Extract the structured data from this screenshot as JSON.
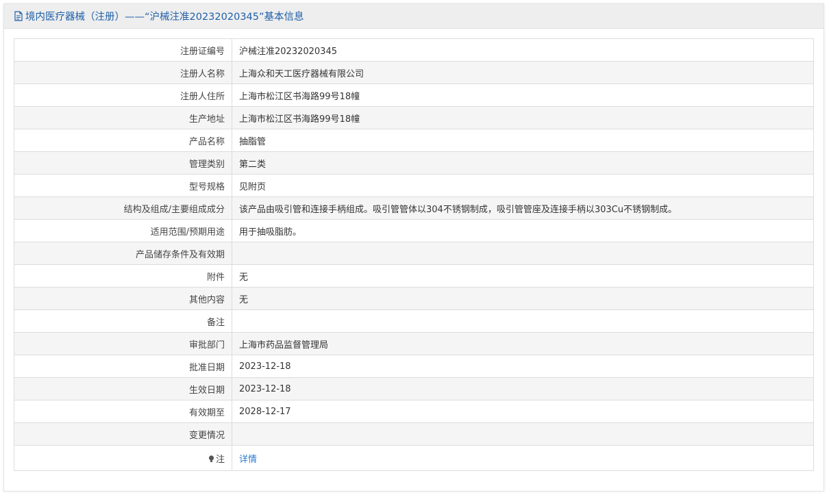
{
  "header": {
    "title": "境内医疗器械（注册）——“沪械注准20232020345”基本信息",
    "icon": "document-icon",
    "color": "#1e5fa8"
  },
  "rows": [
    {
      "label": "注册证编号",
      "value": "沪械注准20232020345"
    },
    {
      "label": "注册人名称",
      "value": "上海众和天工医疗器械有限公司"
    },
    {
      "label": "注册人住所",
      "value": "上海市松江区书海路99号18幢"
    },
    {
      "label": "生产地址",
      "value": "上海市松江区书海路99号18幢"
    },
    {
      "label": "产品名称",
      "value": "抽脂管"
    },
    {
      "label": "管理类别",
      "value": "第二类"
    },
    {
      "label": "型号规格",
      "value": "见附页"
    },
    {
      "label": "结构及组成/主要组成成分",
      "value": "该产品由吸引管和连接手柄组成。吸引管管体以304不锈钢制成，吸引管管座及连接手柄以303Cu不锈钢制成。"
    },
    {
      "label": "适用范围/预期用途",
      "value": "用于抽吸脂肪。"
    },
    {
      "label": "产品储存条件及有效期",
      "value": ""
    },
    {
      "label": "附件",
      "value": "无"
    },
    {
      "label": "其他内容",
      "value": "无"
    },
    {
      "label": "备注",
      "value": ""
    },
    {
      "label": "审批部门",
      "value": "上海市药品监督管理局"
    },
    {
      "label": "批准日期",
      "value": "2023-12-18"
    },
    {
      "label": "生效日期",
      "value": "2023-12-18"
    },
    {
      "label": "有效期至",
      "value": "2028-12-17"
    },
    {
      "label": "变更情况",
      "value": ""
    }
  ],
  "note_row": {
    "label": "注",
    "icon": "bulb-icon",
    "link_text": "详情",
    "link_color": "#2a7ad1"
  }
}
